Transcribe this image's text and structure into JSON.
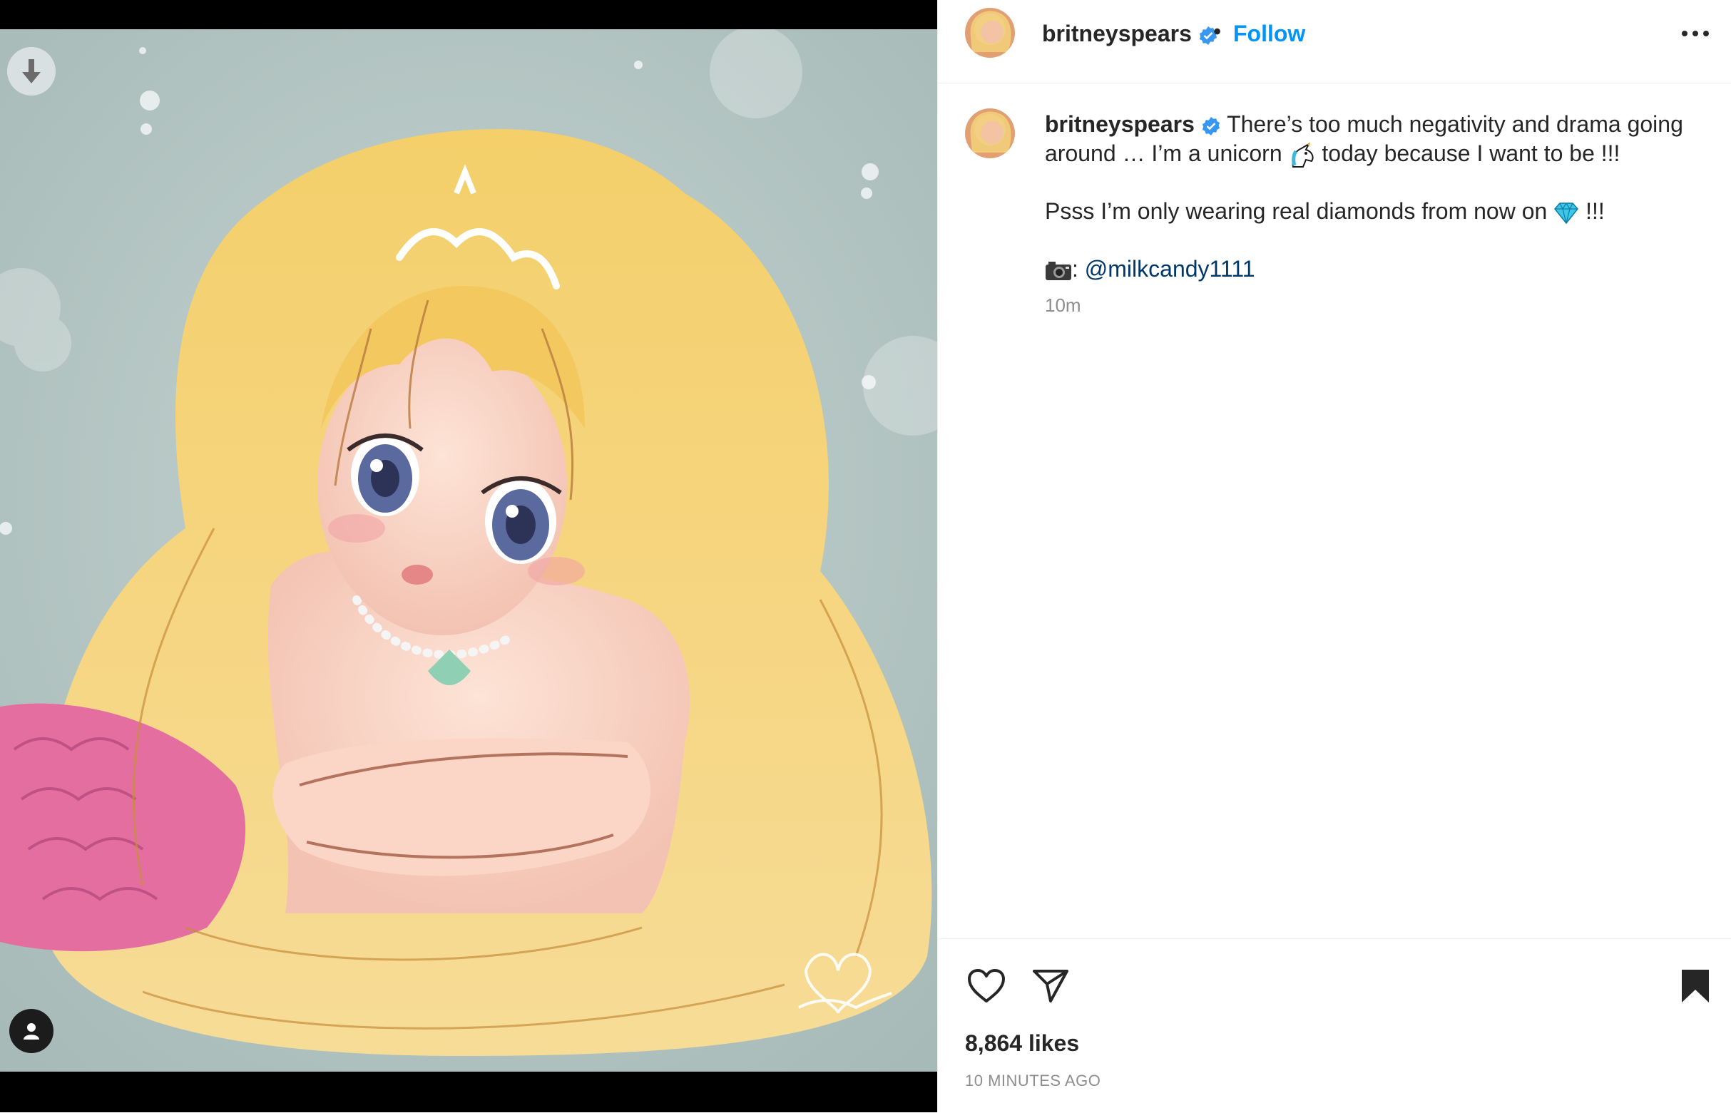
{
  "post": {
    "username": "britneyspears",
    "verified": true,
    "follow_label": "Follow",
    "header_separator": "•",
    "caption": {
      "line1a": "There’s too much negativity and drama going",
      "line1b_pre": "around … I’m a unicorn",
      "line1b_post": "today because I want to be !!!",
      "line2_pre": "Psss I’m only wearing real diamonds from now on",
      "line2_post": "!!!",
      "credit_sep": ":",
      "credit_mention": "@milkcandy1111"
    },
    "time_ago": "10m",
    "likes": "8,864 likes",
    "date": "10 MINUTES AGO"
  },
  "icons": {
    "download": "download-arrow-icon",
    "tag": "user-tag-icon",
    "more": "more-options-icon",
    "verified": "verified-badge-icon",
    "like": "heart-icon",
    "share": "paper-plane-icon",
    "save": "bookmark-icon",
    "unicorn": "unicorn-emoji-icon",
    "diamond": "diamond-emoji-icon",
    "camera": "camera-emoji-icon"
  },
  "colors": {
    "follow": "#0095f6",
    "verified": "#3897f0",
    "mention": "#00376b",
    "muted": "#8e8e8e"
  }
}
